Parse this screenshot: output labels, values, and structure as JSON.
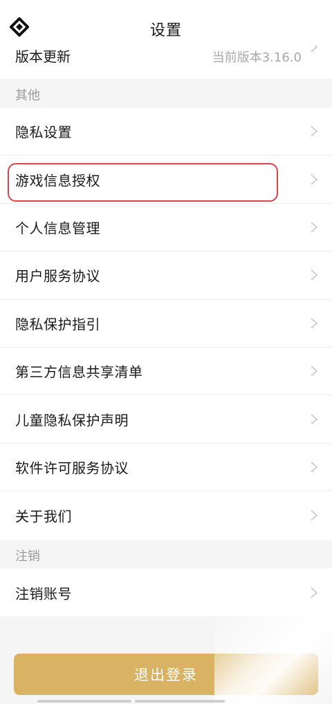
{
  "header": {
    "title": "设置",
    "logo_icon": "diamond-logo-icon"
  },
  "version_row": {
    "label": "版本更新",
    "value": "当前版本3.16.0"
  },
  "sections": {
    "other": {
      "title": "其他",
      "items": [
        {
          "label": "隐私设置"
        },
        {
          "label": "游戏信息授权"
        },
        {
          "label": "个人信息管理"
        },
        {
          "label": "用户服务协议"
        },
        {
          "label": "隐私保护指引"
        },
        {
          "label": "第三方信息共享清单"
        },
        {
          "label": "儿童隐私保护声明"
        },
        {
          "label": "软件许可服务协议"
        },
        {
          "label": "关于我们"
        }
      ]
    },
    "cancel": {
      "title": "注销",
      "items": [
        {
          "label": "注销账号"
        }
      ]
    }
  },
  "logout_button": "退出登录",
  "colors": {
    "accent": "#d9b263",
    "highlight": "#e0404a",
    "background": "#f5f5f5"
  }
}
